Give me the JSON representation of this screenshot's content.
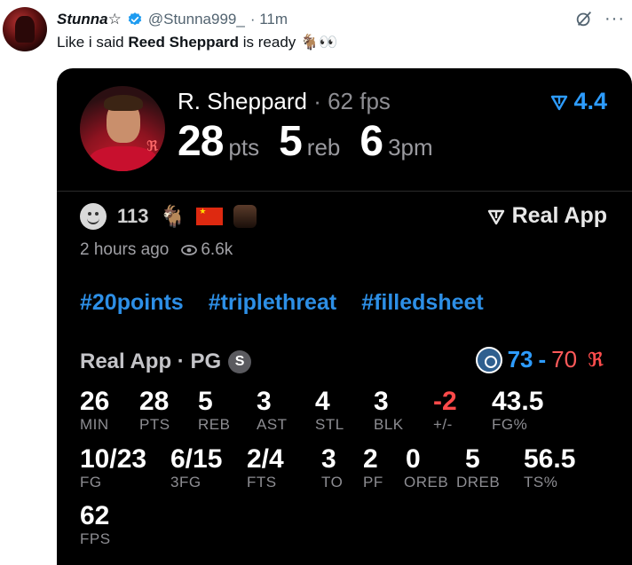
{
  "tweet": {
    "display_name": "Stunna☆",
    "handle": "@Stunna999_",
    "time": "· 11m",
    "text_before": "Like i said ",
    "text_bold": "Reed Sheppard",
    "text_after": " is ready 🐐👀"
  },
  "card": {
    "player_name": "R. Sheppard",
    "fps_label": " · 62 fps",
    "rating": "4.4",
    "big_stats": [
      {
        "value": "28",
        "label": "pts"
      },
      {
        "value": "5",
        "label": "reb"
      },
      {
        "value": "6",
        "label": "3pm"
      }
    ],
    "reaction_count": "113",
    "real_app_label": "Real App",
    "time_ago": "2 hours ago",
    "views": "6.6k",
    "hashtags": [
      "#20points",
      "#triplethreat",
      "#filledsheet"
    ],
    "section_title": "Real App · PG",
    "section_badge": "S",
    "score_home": "73",
    "score_dash": "-",
    "score_away": "70",
    "stats_row1": [
      {
        "value": "26",
        "label": "MIN"
      },
      {
        "value": "28",
        "label": "PTS"
      },
      {
        "value": "5",
        "label": "REB"
      },
      {
        "value": "3",
        "label": "AST"
      },
      {
        "value": "4",
        "label": "STL"
      },
      {
        "value": "3",
        "label": "BLK"
      },
      {
        "value": "-2",
        "label": "+/-"
      },
      {
        "value": "43.5",
        "label": "FG%"
      }
    ],
    "stats_row2": [
      {
        "value": "10/23",
        "label": "FG"
      },
      {
        "value": "6/15",
        "label": "3FG"
      },
      {
        "value": "2/4",
        "label": "FTS"
      },
      {
        "value": "3",
        "label": "TO"
      },
      {
        "value": "2",
        "label": "PF"
      },
      {
        "value": "0",
        "label": "OREB"
      },
      {
        "value": "5",
        "label": "DREB"
      },
      {
        "value": "56.5",
        "label": "TS%"
      }
    ],
    "stats_row3": [
      {
        "value": "62",
        "label": "FPS"
      }
    ]
  },
  "colors": {
    "accent_blue": "#2d9cff",
    "negative_red": "#ff4a4a",
    "card_bg": "#000000"
  },
  "icons": [
    "verified-badge-icon",
    "grok-icon",
    "more-icon",
    "rating-arrow-icon",
    "real-app-logo-icon",
    "eye-icon",
    "smile-reaction-icon",
    "goat-icon",
    "china-flag-icon",
    "team-logo-icon",
    "rockets-logo-icon"
  ]
}
